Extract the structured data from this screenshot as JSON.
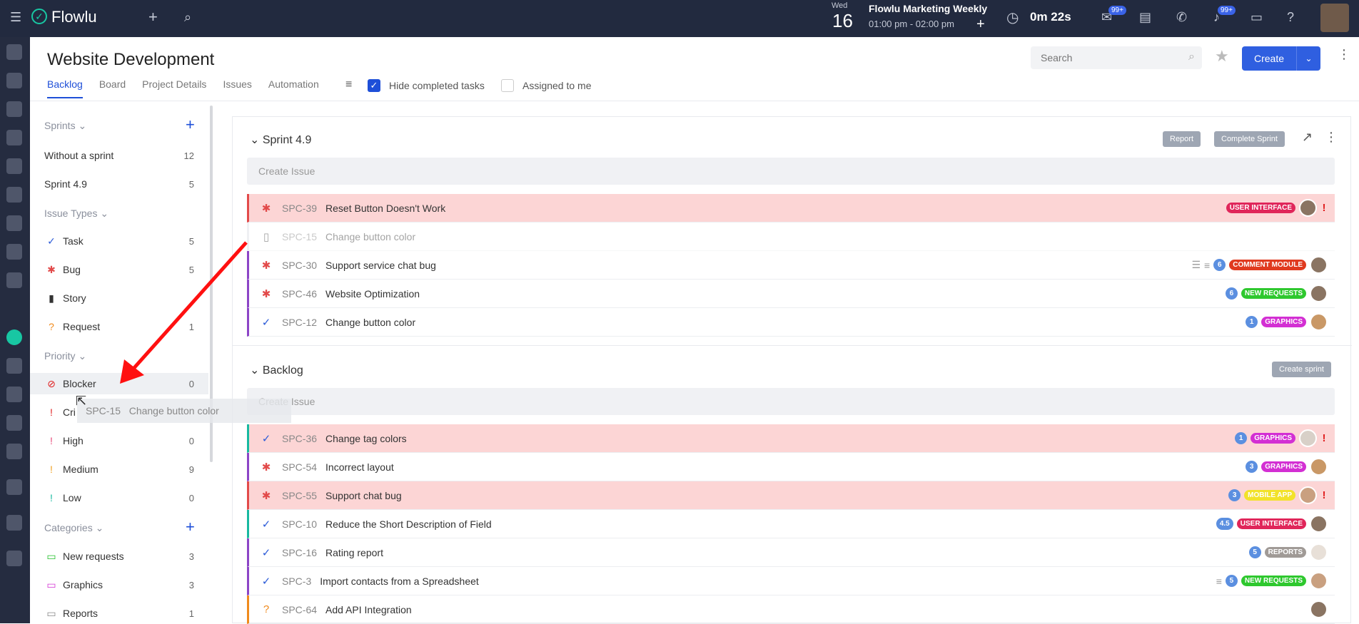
{
  "app": {
    "name": "Flowlu"
  },
  "topbar": {
    "event_day_name": "Wed",
    "event_day_num": "16",
    "event_title": "Flowlu Marketing Weekly",
    "event_time": "01:00 pm - 02:00 pm",
    "timer": "0m 22s",
    "mail_badge": "99+",
    "notif_badge": "99+"
  },
  "project": {
    "title": "Website Development",
    "tabs": [
      "Backlog",
      "Board",
      "Project Details",
      "Issues",
      "Automation"
    ],
    "hide_completed": "Hide completed tasks",
    "assigned_to_me": "Assigned to me",
    "search_placeholder": "Search",
    "create_label": "Create"
  },
  "sidebar": {
    "sprints_head": "Sprints",
    "sprints": [
      {
        "label": "Without a sprint",
        "count": "12"
      },
      {
        "label": "Sprint 4.9",
        "count": "5"
      }
    ],
    "types_head": "Issue Types",
    "types": [
      {
        "label": "Task",
        "count": "5"
      },
      {
        "label": "Bug",
        "count": "5"
      },
      {
        "label": "Story",
        "count": ""
      },
      {
        "label": "Request",
        "count": "1"
      }
    ],
    "priority_head": "Priority",
    "priorities": [
      {
        "label": "Blocker",
        "count": "0"
      },
      {
        "label": "Cri",
        "count": ""
      },
      {
        "label": "High",
        "count": "0"
      },
      {
        "label": "Medium",
        "count": "9"
      },
      {
        "label": "Low",
        "count": "0"
      }
    ],
    "categories_head": "Categories",
    "categories": [
      {
        "label": "New requests",
        "count": "3"
      },
      {
        "label": "Graphics",
        "count": "3"
      },
      {
        "label": "Reports",
        "count": "1"
      }
    ]
  },
  "sprint": {
    "title": "Sprint 4.9",
    "report": "Report",
    "complete": "Complete Sprint",
    "create_issue": "Create Issue",
    "rows": [
      {
        "key": "SPC-39",
        "title": "Reset Button Doesn't Work",
        "badge": "USER INTERFACE",
        "num": ""
      },
      {
        "key": "SPC-15",
        "title": "Change button color",
        "badge": "",
        "num": ""
      },
      {
        "key": "SPC-30",
        "title": "Support service chat bug",
        "badge": "COMMENT MODULE",
        "num": "6"
      },
      {
        "key": "SPC-46",
        "title": "Website Optimization",
        "badge": "NEW REQUESTS",
        "num": "6"
      },
      {
        "key": "SPC-12",
        "title": "Change button color",
        "badge": "GRAPHICS",
        "num": "1"
      }
    ]
  },
  "backlog": {
    "title": "Backlog",
    "create_sprint": "Create sprint",
    "create_issue": "Create Issue",
    "rows": [
      {
        "key": "SPC-36",
        "title": "Change tag colors",
        "badge": "GRAPHICS",
        "num": "1"
      },
      {
        "key": "SPC-54",
        "title": "Incorrect layout",
        "badge": "GRAPHICS",
        "num": "3"
      },
      {
        "key": "SPC-55",
        "title": "Support chat bug",
        "badge": "MOBILE APP",
        "num": "3"
      },
      {
        "key": "SPC-10",
        "title": "Reduce the Short Description of Field",
        "badge": "USER INTERFACE",
        "num": "4.5"
      },
      {
        "key": "SPC-16",
        "title": "Rating report",
        "badge": "REPORTS",
        "num": "5"
      },
      {
        "key": "SPC-3",
        "title": "Import contacts from a Spreadsheet",
        "badge": "NEW REQUESTS",
        "num": "5"
      },
      {
        "key": "SPC-64",
        "title": "Add API Integration",
        "badge": "",
        "num": ""
      }
    ]
  },
  "drag_ghost": {
    "key": "SPC-15",
    "title": "Change button color"
  },
  "colors": {
    "accent": "#1e4fd8",
    "topbar": "#222a3f",
    "bug": "#e24a4a",
    "red_row": "#fcd5d5"
  }
}
